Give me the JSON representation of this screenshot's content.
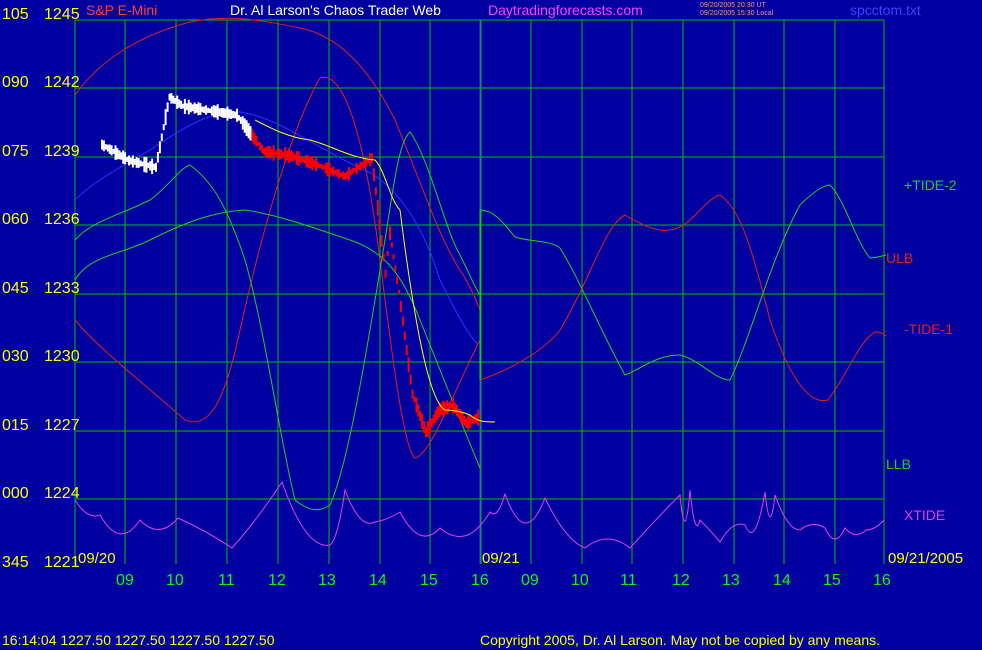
{
  "header": {
    "instrument": "S&P E-Mini",
    "author": "Dr. Al Larson's Chaos Trader Web",
    "site": "Daytradingforecasts.com",
    "ts1": "09/20/2005 20:30 UT",
    "ts2": "09/20/2005 15:30 Local",
    "file": "spcctom.txt"
  },
  "footer": {
    "status": "16:14:04  1227.50 1227.50 1227.50 1227.50",
    "copyright": "Copyright 2005, Dr. Al Larson. May not be copied by any means."
  },
  "colors": {
    "background": "#0000a0",
    "grid": "#00c000",
    "price": "#ffffff",
    "price_down": "#ff0000",
    "moving_avg": "#ffff00",
    "slow_avg": "#3030ff",
    "tide": "#20d020",
    "red_line": "#e02020",
    "xtide": "#e040e0"
  },
  "chart_data": {
    "type": "line",
    "y_axis": {
      "price_labels": [
        "1245",
        "1242",
        "1239",
        "1236",
        "1233",
        "1230",
        "1227",
        "1224",
        "1221"
      ],
      "angle_labels": [
        "105",
        "090",
        "075",
        "060",
        "045",
        "030",
        "015",
        "000",
        "345"
      ],
      "ylim": [
        1221,
        1245
      ]
    },
    "x_axis": {
      "hour_labels": [
        "09",
        "10",
        "11",
        "12",
        "13",
        "14",
        "15",
        "16",
        "09",
        "10",
        "11",
        "12",
        "13",
        "14",
        "15",
        "16"
      ],
      "date_labels": [
        "09/20",
        "09/21",
        "09/21/2005"
      ]
    },
    "series_labels": [
      "+TIDE-2",
      "ULB",
      "-TIDE-1",
      "LLB",
      "XTIDE"
    ],
    "price_bars_sample": [
      {
        "t": "09:00",
        "p": 1239.5
      },
      {
        "t": "09:30",
        "p": 1238.8
      },
      {
        "t": "10:00",
        "p": 1238.5
      },
      {
        "t": "10:15",
        "p": 1241.6
      },
      {
        "t": "10:30",
        "p": 1241.2
      },
      {
        "t": "11:00",
        "p": 1241.0
      },
      {
        "t": "11:30",
        "p": 1240.8
      },
      {
        "t": "12:00",
        "p": 1239.2
      },
      {
        "t": "12:30",
        "p": 1239.0
      },
      {
        "t": "13:00",
        "p": 1238.6
      },
      {
        "t": "13:30",
        "p": 1238.1
      },
      {
        "t": "14:00",
        "p": 1238.9
      },
      {
        "t": "14:15",
        "p": 1233.8
      },
      {
        "t": "14:20",
        "p": 1235.6
      },
      {
        "t": "14:30",
        "p": 1233.0
      },
      {
        "t": "14:45",
        "p": 1228.5
      },
      {
        "t": "15:00",
        "p": 1226.8
      },
      {
        "t": "15:15",
        "p": 1227.8
      },
      {
        "t": "15:30",
        "p": 1228.0
      },
      {
        "t": "15:45",
        "p": 1227.2
      },
      {
        "t": "16:00",
        "p": 1227.5
      }
    ]
  }
}
